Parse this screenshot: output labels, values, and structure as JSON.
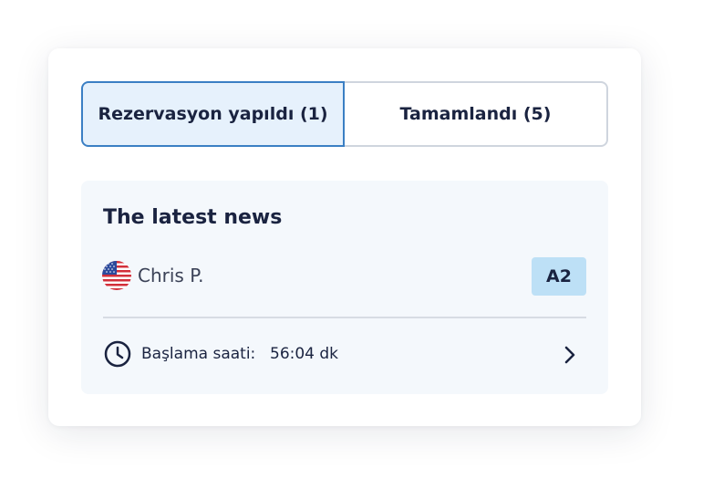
{
  "tabs": [
    {
      "label": "Rezervasyon yapıldı (1)",
      "active": true
    },
    {
      "label": "Tamamlandı (5)",
      "active": false
    }
  ],
  "news": {
    "title": "The latest news",
    "user": {
      "name": "Chris P.",
      "flag_icon": "us-flag-icon"
    },
    "level": "A2",
    "start_label": "Başlama saati:",
    "start_value": "56:04 dk"
  },
  "colors": {
    "active_tab_bg": "#e6f1fc",
    "active_tab_border": "#3b7fc4",
    "badge_bg": "#bde0f6",
    "text": "#1a2340"
  }
}
